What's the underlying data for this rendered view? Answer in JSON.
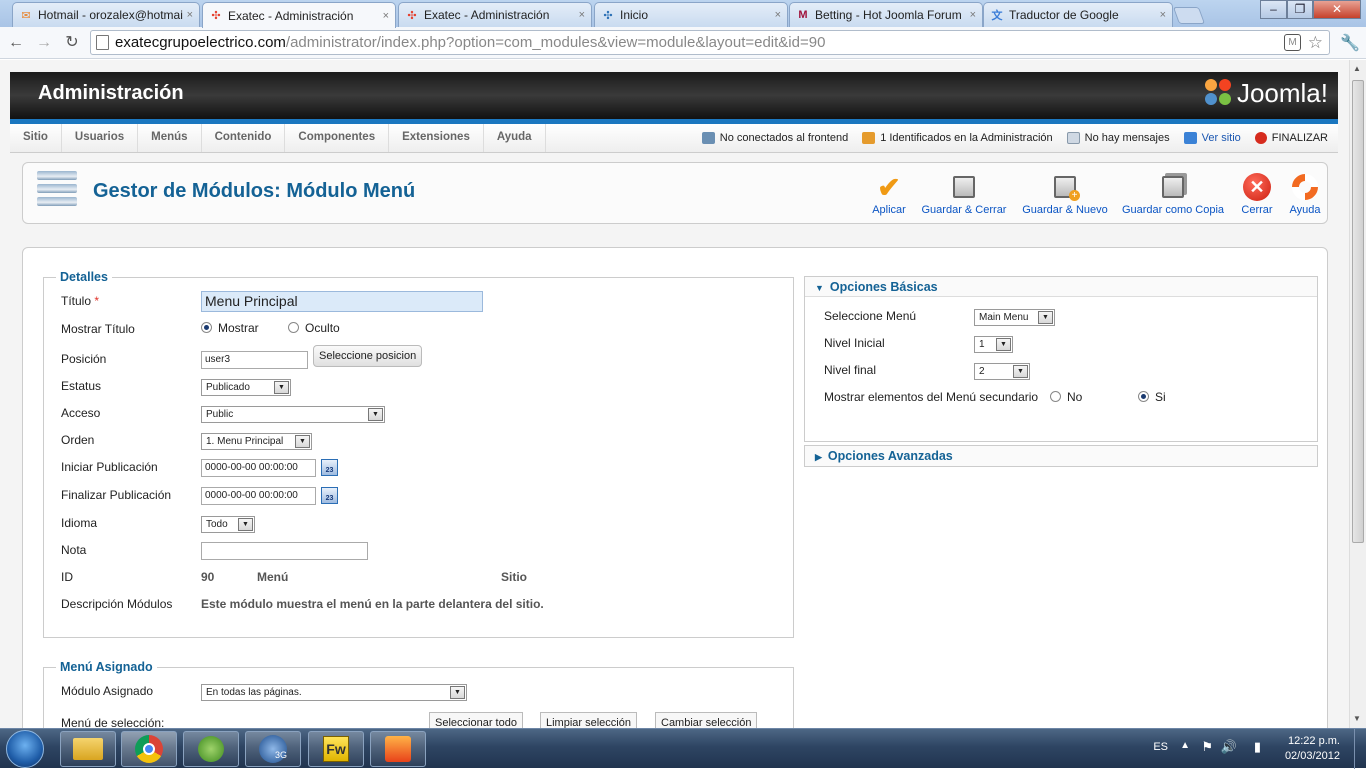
{
  "browser": {
    "tabs": [
      {
        "title": "Hotmail - orozalex@hotmai",
        "icon": "hotmail-icon",
        "active": false
      },
      {
        "title": "Exatec - Administración",
        "icon": "joomla-icon",
        "active": true
      },
      {
        "title": "Exatec - Administración",
        "icon": "joomla-icon",
        "active": false
      },
      {
        "title": "Inicio",
        "icon": "joomla-icon",
        "active": false
      },
      {
        "title": "Betting - Hot Joomla Forum",
        "icon": "forum-icon",
        "active": false
      },
      {
        "title": "Traductor de Google",
        "icon": "translate-icon",
        "active": false
      }
    ],
    "tab_close": "×",
    "url_domain": "exatecgrupoelectrico.com",
    "url_path": "/administrator/index.php?option=com_modules&view=module&layout=edit&id=90"
  },
  "header": {
    "title": "Administración",
    "logo_text": "Joomla!"
  },
  "menu": {
    "items": [
      "Sitio",
      "Usuarios",
      "Menús",
      "Contenido",
      "Componentes",
      "Extensiones",
      "Ayuda"
    ]
  },
  "status": {
    "frontend": "No conectados al frontend",
    "admins": "1 Identificados en la Administración",
    "messages": "No hay mensajes",
    "view_site": "Ver sitio",
    "logout": "FINALIZAR"
  },
  "toolbar": {
    "title": "Gestor de Módulos: Módulo Menú",
    "apply": "Aplicar",
    "save_close": "Guardar & Cerrar",
    "save_new": "Guardar & Nuevo",
    "save_copy": "Guardar como Copia",
    "close": "Cerrar",
    "help": "Ayuda"
  },
  "details": {
    "legend": "Detalles",
    "title_label": "Título",
    "required_mark": "*",
    "title_value": "Menu Principal",
    "show_title_label": "Mostrar Título",
    "show_option": "Mostrar",
    "hide_option": "Oculto",
    "position_label": "Posición",
    "position_value": "user3",
    "position_button": "Seleccione posicion",
    "status_label": "Estatus",
    "status_value": "Publicado",
    "access_label": "Acceso",
    "access_value": "Public",
    "order_label": "Orden",
    "order_value": "1. Menu Principal",
    "publish_up_label": "Iniciar Publicación",
    "publish_up_value": "0000-00-00 00:00:00",
    "publish_down_label": "Finalizar Publicación",
    "publish_down_value": "0000-00-00 00:00:00",
    "calendar_text": "23",
    "language_label": "Idioma",
    "language_value": "Todo",
    "note_label": "Nota",
    "note_value": "",
    "id_label": "ID",
    "id_value": "90",
    "module_type": "Menú",
    "client": "Sitio",
    "description_label": "Descripción Módulos",
    "description_value": "Este módulo muestra el menú en la parte delantera del sitio."
  },
  "assignment": {
    "legend": "Menú Asignado",
    "module_assigned_label": "Módulo Asignado",
    "module_assigned_value": "En todas las páginas.",
    "selection_label": "Menú de selección:",
    "select_all": "Seleccionar todo",
    "clear_selection": "Limpiar selección",
    "toggle_selection": "Cambiar selección"
  },
  "basic_options": {
    "title": "Opciones Básicas",
    "menu_label": "Seleccione Menú",
    "menu_value": "Main Menu",
    "start_level_label": "Nivel Inicial",
    "start_level_value": "1",
    "end_level_label": "Nivel final",
    "end_level_value": "2",
    "show_sub_label": "Mostrar elementos del Menú secundario",
    "no_option": "No",
    "yes_option": "Si"
  },
  "advanced_options": {
    "title": "Opciones Avanzadas"
  },
  "taskbar": {
    "language": "ES",
    "time": "12:22 p.m.",
    "date": "02/03/2012",
    "fw_label": "Fw",
    "badge_3g": "3G"
  },
  "colors": {
    "accent": "#146295",
    "header_bar": "#1b77c0",
    "link": "#0b55c4"
  }
}
